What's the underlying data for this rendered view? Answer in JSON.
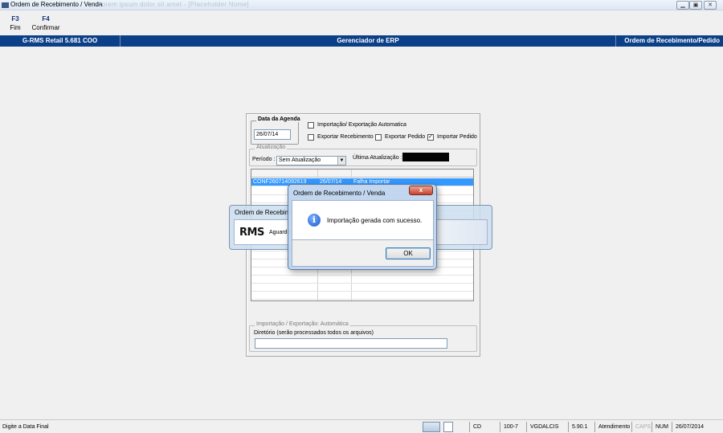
{
  "window": {
    "title": "Ordem de Recebimento / Venda",
    "title_blurred": "Lorem ipsum dolor sit amet - [Placeholder Nome]",
    "controls": [
      "minimize",
      "restore",
      "close"
    ]
  },
  "toolbar": {
    "buttons": [
      {
        "key": "F3",
        "label": "Fim"
      },
      {
        "key": "F4",
        "label": "Confirmar"
      }
    ]
  },
  "header": {
    "left": "G-RMS Retail 5.681 COO",
    "center": "Gerenciador de ERP",
    "right": "Ordem de Recebimento/Pedido",
    "color": "#0b3f88"
  },
  "form": {
    "agenda_legend": "Data da Agenda",
    "agenda_value": "26/07/14",
    "auto_import_label": "Importação/ Exportação Automatica",
    "auto_import_checked": false,
    "export_receb_label": "Exportar Recebimento",
    "export_receb_checked": false,
    "export_pedido_label": "Exportar Pedido",
    "export_pedido_checked": false,
    "import_pedido_label": "Importar Pedido",
    "import_pedido_checked": true,
    "atualizacao_legend": "Atualização",
    "periodo_label": "Período :",
    "periodo_value": "Sem Atualização",
    "ultima_label": "Última Atualização :",
    "auto_legend": "Importação / Exportação: Automática",
    "diretorio_label": "Diretório (serão processados todos os arquivos)",
    "diretorio_value": ""
  },
  "grid": {
    "rows": [
      {
        "col1": "CONF260714092619",
        "col2": "26/07/14",
        "col3": "Falha Importar",
        "selected": true
      }
    ],
    "empty_rows": 14
  },
  "progress_dialog": {
    "title": "Ordem de Recebime",
    "logo": "RMS",
    "message": "Aguarde,"
  },
  "message_dialog": {
    "title": "Ordem de Recebimento / Venda",
    "close_glyph": "x",
    "icon": "info-icon",
    "message": "Importação gerada com sucesso.",
    "ok_label": "OK"
  },
  "statusbar": {
    "hint": "Digite a Data Final",
    "fields": [
      "CD",
      "100-7",
      "VGDALCIS",
      "5.90.1",
      "Atendimento",
      "CAPS",
      "NUM",
      "26/07/2014"
    ]
  }
}
